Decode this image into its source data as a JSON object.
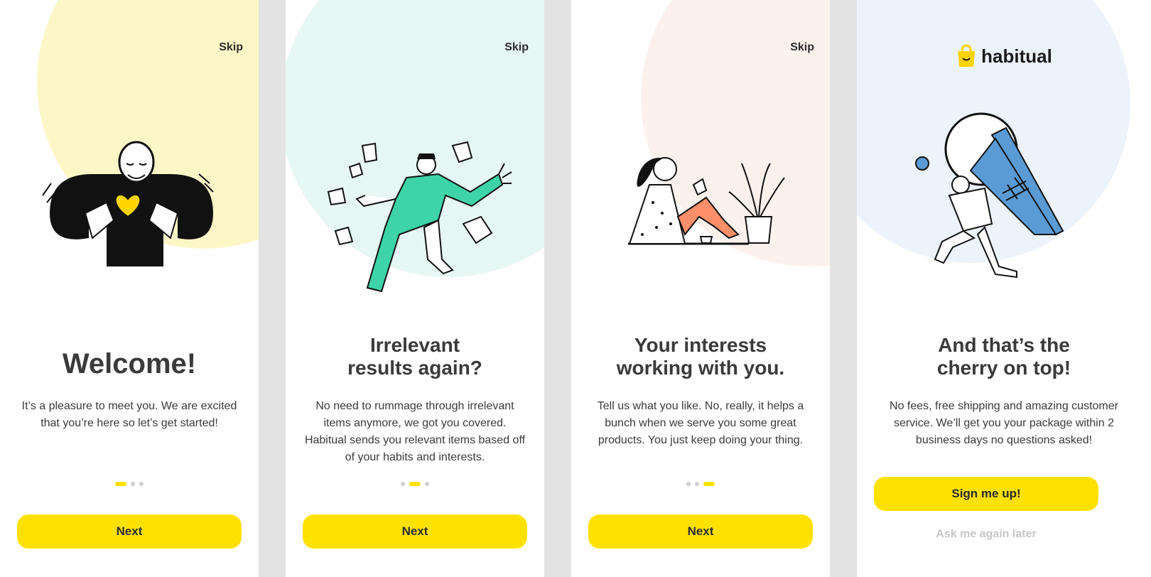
{
  "screens": [
    {
      "skip": "Skip",
      "title": "Welcome!",
      "body": "It’s a pleasure to meet you. We are excited that you’re here so let’s get started!",
      "button": "Next",
      "active_dot": 1,
      "blob_color": "#fdf7c8",
      "illustration": "man-holding-heart"
    },
    {
      "skip": "Skip",
      "title_line1": "Irrelevant",
      "title_line2": "results again?",
      "body": "No need to rummage through irrelevant items anymore, we got you covered. Habitual sends you relevant items based off of your habits and interests.",
      "button": "Next",
      "active_dot": 2,
      "blob_color": "#e7f7f3",
      "illustration": "man-running-with-papers"
    },
    {
      "skip": "Skip",
      "title_line1": "Your interests",
      "title_line2": "working with you.",
      "body": "Tell us what you like. No, really, it helps a bunch when we serve you some great products. You just keep doing your thing.",
      "button": "Next",
      "active_dot": 3,
      "blob_color": "#fdf1ee",
      "illustration": "woman-reading-with-plant"
    },
    {
      "logo_text": "habitual",
      "title_line1": "And that’s the",
      "title_line2": "cherry on top!",
      "body": "No fees, free shipping and amazing customer service. We’ll get you your package within 2 business days no questions asked!",
      "button": "Sign me up!",
      "secondary": "Ask me again later",
      "blob_color": "#edf3fb",
      "illustration": "girl-carrying-ice-cream"
    }
  ],
  "colors": {
    "accent": "#ffe100",
    "background": "#e3e3e3",
    "text": "#2b2b2b",
    "muted": "#c6c6c6"
  }
}
